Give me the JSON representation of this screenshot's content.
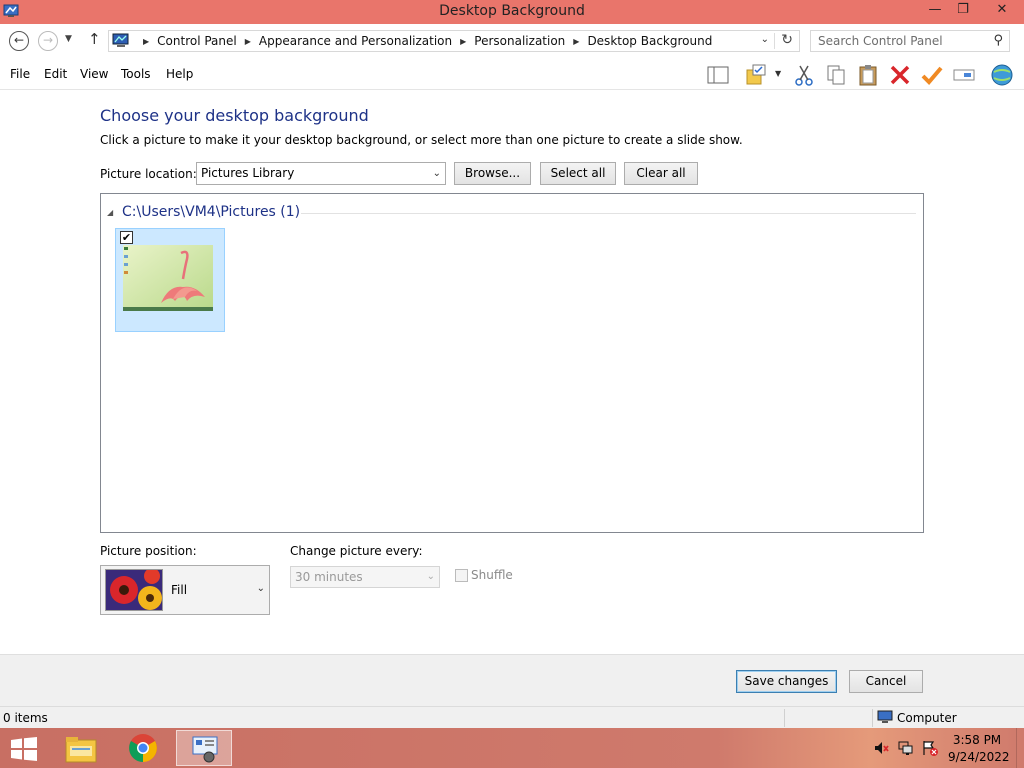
{
  "window": {
    "title": "Desktop Background",
    "minimize_glyph": "—",
    "maximize_glyph": "❐",
    "close_glyph": "✕"
  },
  "address": {
    "breadcrumbs": [
      "Control Panel",
      "Appearance and Personalization",
      "Personalization",
      "Desktop Background"
    ],
    "search_placeholder": "Search Control Panel"
  },
  "menu": [
    "File",
    "Edit",
    "View",
    "Tools",
    "Help"
  ],
  "toolbar_icons": [
    "panes-icon",
    "folder-options-icon",
    "cut-icon",
    "copy-icon",
    "paste-icon",
    "delete-icon",
    "properties-check-icon",
    "rename-icon",
    "globe-icon"
  ],
  "content": {
    "title": "Choose your desktop background",
    "subtitle": "Click a picture to make it your desktop background, or select more than one picture to create a slide show.",
    "location_label": "Picture location:",
    "location_value": "Pictures Library",
    "browse_label": "Browse...",
    "select_all_label": "Select all",
    "clear_all_label": "Clear all",
    "group_header": "C:\\Users\\VM4\\Pictures (1)",
    "thumbnails": [
      {
        "checked": true,
        "check_glyph": "✔"
      }
    ],
    "position_label": "Picture position:",
    "position_value": "Fill",
    "change_label": "Change picture every:",
    "interval_value": "30 minutes",
    "shuffle_label": "Shuffle"
  },
  "footer": {
    "save_label": "Save changes",
    "cancel_label": "Cancel"
  },
  "status": {
    "items": "0 items",
    "location": "Computer"
  },
  "taskbar": {
    "time": "3:58 PM",
    "date": "9/24/2022"
  },
  "colors": {
    "titlebar": "#e9756b",
    "heading": "#1e3287",
    "selection": "#cce8ff"
  }
}
